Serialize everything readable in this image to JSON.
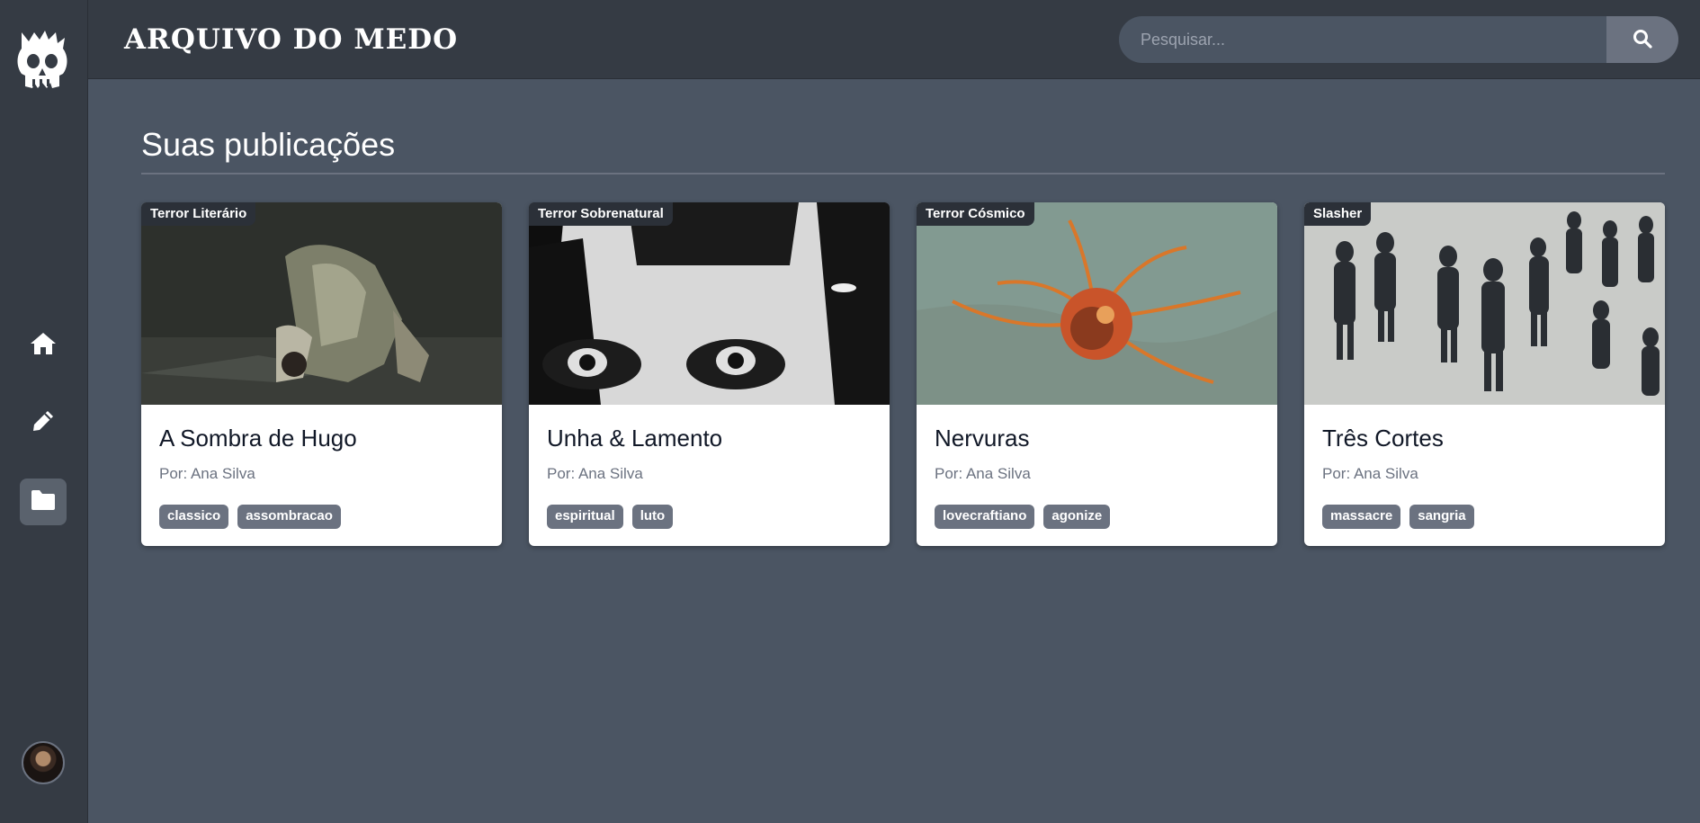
{
  "header": {
    "brand": "ARQUIVO DO MEDO",
    "search_placeholder": "Pesquisar..."
  },
  "sidebar": {
    "items": [
      {
        "icon": "home-icon",
        "active": false
      },
      {
        "icon": "pencil-icon",
        "active": false
      },
      {
        "icon": "folder-icon",
        "active": true
      }
    ]
  },
  "main": {
    "title": "Suas publicações",
    "cards": [
      {
        "genre": "Terror Literário",
        "title": "A Sombra de Hugo",
        "author": "Por: Ana Silva",
        "tags": [
          "classico",
          "assombracao"
        ]
      },
      {
        "genre": "Terror Sobrenatural",
        "title": "Unha & Lamento",
        "author": "Por: Ana Silva",
        "tags": [
          "espiritual",
          "luto"
        ]
      },
      {
        "genre": "Terror Cósmico",
        "title": "Nervuras",
        "author": "Por: Ana Silva",
        "tags": [
          "lovecraftiano",
          "agonize"
        ]
      },
      {
        "genre": "Slasher",
        "title": "Três Cortes",
        "author": "Por: Ana Silva",
        "tags": [
          "massacre",
          "sangria"
        ]
      }
    ]
  },
  "colors": {
    "background": "#4b5563",
    "sidebar": "#353b44",
    "tag": "#6b7280"
  }
}
